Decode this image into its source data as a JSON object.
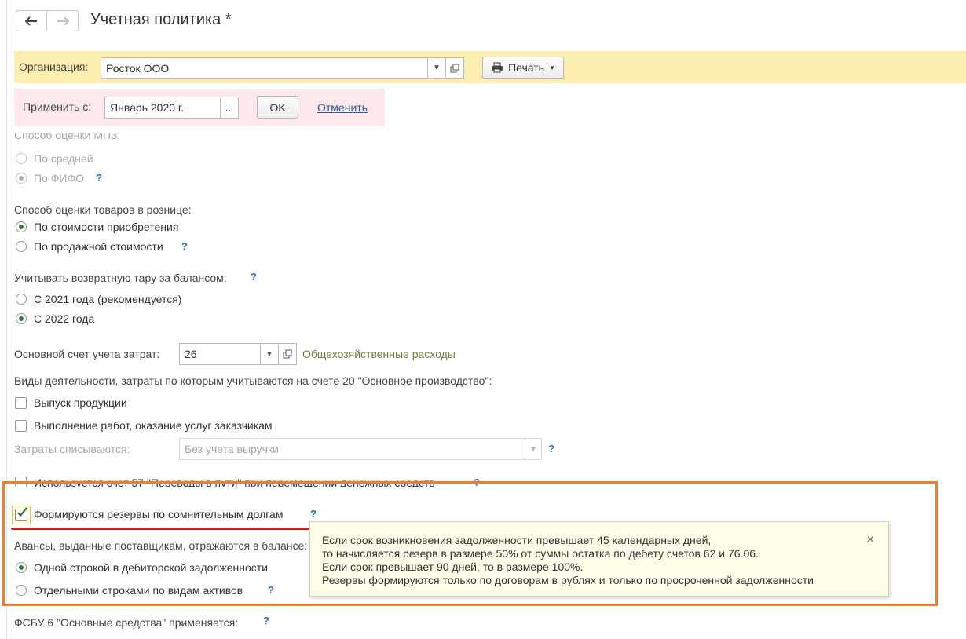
{
  "header": {
    "back_icon": "arrow-left-icon",
    "forward_icon": "arrow-right-icon",
    "title": "Учетная политика *"
  },
  "org_bar": {
    "label": "Организация:",
    "value": "Росток ООО",
    "print_label": "Печать"
  },
  "apply_bar": {
    "label": "Применить с:",
    "date_value": "Январь 2020 г.",
    "select_button": "...",
    "ok_label": "OK",
    "cancel_label": "Отменить"
  },
  "mpz": {
    "partial_label": "Способ оценки МПЗ:",
    "options": [
      "По средней",
      "По ФИФО"
    ],
    "selected": 1
  },
  "retail": {
    "label": "Способ оценки товаров в рознице:",
    "options": [
      "По стоимости приобретения",
      "По продажной стоимости"
    ],
    "selected": 0
  },
  "tare": {
    "label": "Учитывать возвратную тару за балансом:",
    "options": [
      "С 2021 года (рекомендуется)",
      "С 2022 года"
    ],
    "selected": 1
  },
  "cost_account": {
    "label": "Основной счет учета затрат:",
    "value": "26",
    "description": "Общехозяйственные расходы"
  },
  "activities": {
    "label": "Виды деятельности, затраты по которым учитываются на счете 20 \"Основное производство\":",
    "items": [
      "Выпуск продукции",
      "Выполнение работ, оказание услуг заказчикам"
    ],
    "writeoff_label": "Затраты списываются:",
    "writeoff_value": "Без учета выручки"
  },
  "transit_label": "Используется счет 57 \"Переводы в пути\" при перемещении денежных средств",
  "reserves": {
    "label": "Формируются резервы по сомнительным долгам",
    "checked": true
  },
  "advances": {
    "label": "Авансы, выданные поставщикам, отражаются в балансе:",
    "options": [
      "Одной строкой в дебиторской задолженности",
      "Отдельными строками по видам активов"
    ],
    "selected": 0
  },
  "fsbu_label": "ФСБУ 6 \"Основные средства\" применяется:",
  "tooltip": {
    "lines": [
      "Если срок возникновения задолженности превышает 45 календарных дней,",
      "то начисляется резерв в размере 50% от суммы остатка по дебету счетов 62 и 76.06.",
      "Если срок превышает 90 дней, то в размере 100%.",
      "Резервы формируются только по договорам в рублях и только по просроченной задолженности"
    ],
    "close": "×"
  },
  "help_mark": "?",
  "colors": {
    "highlight_border": "#ed7d31",
    "underline": "#d01c1c",
    "org_bar_bg": "#fbeeb0",
    "apply_bar_bg": "#fde8ec",
    "tooltip_bg": "#fefde8"
  }
}
